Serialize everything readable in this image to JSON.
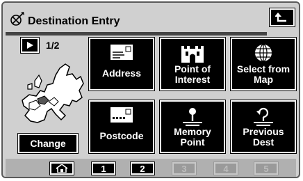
{
  "header": {
    "title": "Destination Entry",
    "nav_icon": "satellite-nav-icon",
    "back_icon": "return-arrow-icon"
  },
  "sidebar": {
    "page_indicator": "1/2",
    "change_label": "Change",
    "map_icon": "europe-map-icon"
  },
  "tiles": [
    {
      "label1": "Address",
      "label2": "",
      "icon": "address-card-icon"
    },
    {
      "label1": "Point of",
      "label2": "Interest",
      "icon": "castle-icon"
    },
    {
      "label1": "Select from",
      "label2": "Map",
      "icon": "globe-icon"
    },
    {
      "label1": "Postcode",
      "label2": "",
      "icon": "postcode-card-icon"
    },
    {
      "label1": "Memory",
      "label2": "Point",
      "icon": "pin-icon"
    },
    {
      "label1": "Previous",
      "label2": "Dest",
      "icon": "previous-dest-icon"
    }
  ],
  "bottom": {
    "home_icon": "home-icon",
    "buttons": [
      "1",
      "2",
      "3",
      "4",
      "5"
    ],
    "enabled": [
      true,
      true,
      false,
      false,
      false
    ]
  }
}
